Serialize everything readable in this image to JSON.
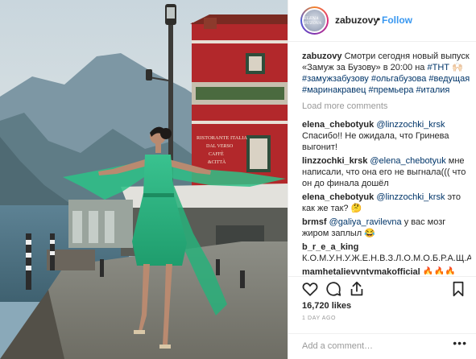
{
  "header": {
    "avatar_text": "ELENA BUZOVA",
    "username": "zabuzovy",
    "separator": "•",
    "follow_label": "Follow"
  },
  "caption": {
    "username": "zabuzovy",
    "text": "Смотри сегодня новый выпуск «Замуж за Бузову» в 20:00 на",
    "tags": [
      "#ТНТ",
      "🙌🏻",
      "#замужзабузову",
      "#ольгабузова",
      "#ведущая",
      "#маринакравец",
      "#премьера",
      "#италия"
    ]
  },
  "load_more_label": "Load more comments",
  "comments": [
    {
      "user": "elena_chebotyuk",
      "mention": "@linzzochki_krsk",
      "text": "Спасибо!! Не ожидала, что Гринева выгонит!"
    },
    {
      "user": "linzzochki_krsk",
      "mention": "@elena_chebotyuk",
      "text": "мне написали, что она его не выгнала((( что он до финала дошёл"
    },
    {
      "user": "elena_chebotyuk",
      "mention": "@linzzochki_krsk",
      "text": "это как же так? 🤔"
    },
    {
      "user": "brmsf",
      "mention": "@galiya_ravilevna",
      "text": "у вас мозг жиром заплыл 😂"
    },
    {
      "user": "b_r_e_a_king",
      "mention": "",
      "text": "К.О.М.У.Н.У.Ж.Е.Н.В.З.Л.О.М.О.Б.Р.А.Щ.А.Й.Т.Е.С.Ь"
    },
    {
      "user": "mamhetalievvntymakofficial",
      "mention": "",
      "text": "🔥🔥🔥"
    }
  ],
  "actions": {
    "like_icon": "heart-icon",
    "comment_icon": "comment-icon",
    "share_icon": "share-icon",
    "save_icon": "bookmark-icon",
    "likes": "16,720 likes",
    "date": "1 DAY AGO",
    "add_comment_placeholder": "Add a comment…",
    "more_label": "•••"
  },
  "photo": {
    "sign_lines": [
      "RISTORANTE ITALIA",
      "DAL VERSO",
      "CAFFÈ",
      "&CITTÀ"
    ]
  },
  "colors": {
    "link": "#3897f0",
    "hashtag": "#003569",
    "muted": "#999999",
    "dress": "#2db37f",
    "building": "#b2282b"
  }
}
